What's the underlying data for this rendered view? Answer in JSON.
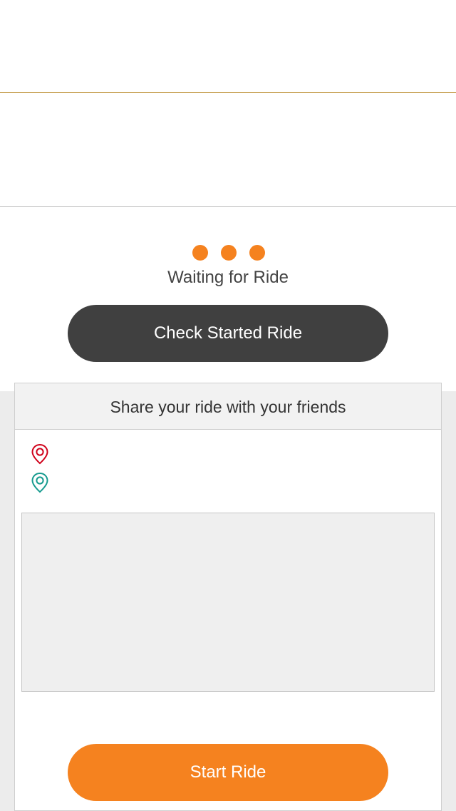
{
  "status": {
    "waiting_text": "Waiting for Ride",
    "dot_color": "#f5821f"
  },
  "check_button": {
    "label": "Check Started Ride",
    "color": "#404040"
  },
  "share_card": {
    "title": "Share your ride with your friends",
    "pickup_label": "",
    "dropoff_label": "",
    "pickup_icon_color": "#d0021b",
    "dropoff_icon_color": "#169b8f"
  },
  "start_button": {
    "label": "Start Ride",
    "color": "#f5821f"
  }
}
